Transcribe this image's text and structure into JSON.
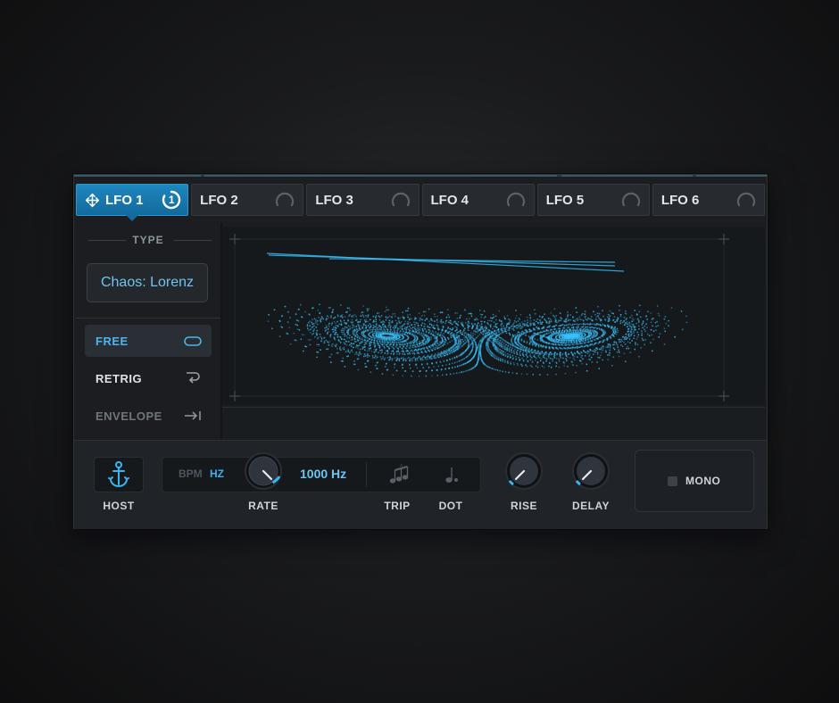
{
  "tabs": [
    {
      "label": "LFO 1",
      "active": true,
      "badge": "1"
    },
    {
      "label": "LFO 2",
      "active": false
    },
    {
      "label": "LFO 3",
      "active": false
    },
    {
      "label": "LFO 4",
      "active": false
    },
    {
      "label": "LFO 5",
      "active": false
    },
    {
      "label": "LFO 6",
      "active": false
    }
  ],
  "type_section": {
    "header": "TYPE",
    "value": "Chaos: Lorenz"
  },
  "modes": [
    {
      "label": "FREE",
      "icon": "loop-icon",
      "selected": true
    },
    {
      "label": "RETRIG",
      "icon": "retrigger-arrow-icon",
      "selected": false
    },
    {
      "label": "ENVELOPE",
      "icon": "arrow-to-line-icon",
      "selected": false
    }
  ],
  "controls": {
    "host_label": "HOST",
    "host_icon": "anchor-icon",
    "bpm_label": "BPM",
    "hz_label": "HZ",
    "rate_label": "RATE",
    "rate_value": "1000 Hz",
    "trip_label": "TRIP",
    "dot_label": "DOT",
    "rise_label": "RISE",
    "delay_label": "DELAY",
    "mono_label": "MONO"
  },
  "colors": {
    "accent": "#1e86bf",
    "scope": "#38c3ff",
    "text_accent": "#6fc4ef"
  }
}
